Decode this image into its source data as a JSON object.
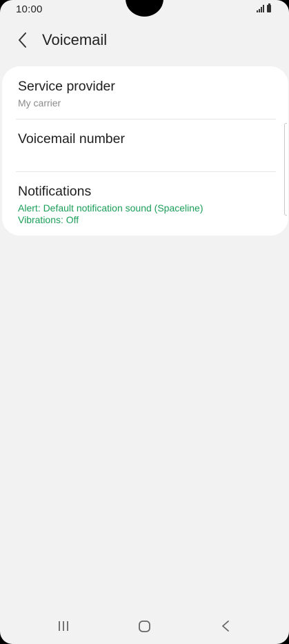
{
  "status_bar": {
    "time": "10:00"
  },
  "header": {
    "back_icon": "chevron-left-icon",
    "title": "Voicemail"
  },
  "settings": [
    {
      "title": "Service provider",
      "subtitle": "My carrier"
    },
    {
      "title": "Voicemail number"
    },
    {
      "title": "Notifications",
      "subtitle_lines": [
        "Alert: Default notification sound (Spaceline)",
        "Vibrations: Off"
      ]
    }
  ],
  "nav_bar": {
    "recents_icon": "recents-icon",
    "home_icon": "home-icon",
    "back_icon": "back-icon"
  },
  "colors": {
    "background": "#f2f2f2",
    "card": "#ffffff",
    "accent_green": "#1a9e57",
    "subtitle_grey": "#8a8a8a"
  }
}
